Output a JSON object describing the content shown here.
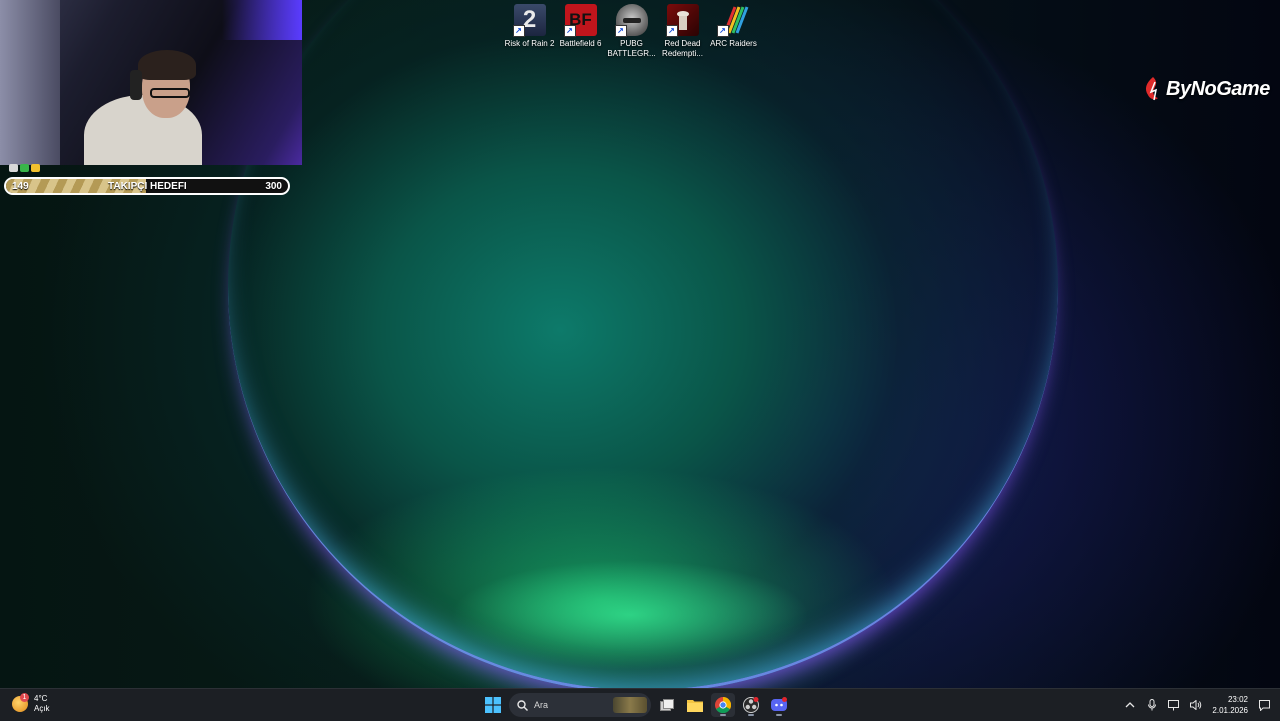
{
  "desktop": {
    "icons": [
      {
        "label": "Risk of Rain 2",
        "icon": "risk-of-rain-2-icon",
        "glyph": "2"
      },
      {
        "label": "Battlefield 6",
        "icon": "battlefield-6-icon",
        "glyph": "BF"
      },
      {
        "label": "PUBG BATTLEGR...",
        "icon": "pubg-icon",
        "glyph": ""
      },
      {
        "label": "Red Dead Redempti...",
        "icon": "red-dead-redemption-icon",
        "glyph": ""
      },
      {
        "label": "ARC Raiders",
        "icon": "arc-raiders-icon",
        "glyph": ""
      }
    ],
    "watermark": "ByNoGame"
  },
  "overlay": {
    "follower_goal": {
      "label": "TAKIPÇI HEDEFI",
      "current": "149",
      "target": "300",
      "progress_fraction": 0.4967
    }
  },
  "taskbar": {
    "weather": {
      "temp": "4°C",
      "condition": "Açık",
      "badge": "1"
    },
    "search_placeholder": "Ara",
    "apps": [
      "start-icon",
      "search-icon",
      "task-view-icon",
      "file-explorer-icon",
      "chrome-icon",
      "obs-icon",
      "discord-icon"
    ],
    "clock": {
      "time": "23:02",
      "date": "2.01.2026"
    }
  },
  "colors": {
    "taskbar_bg": "#1c1f24",
    "progress_fill": "#b49a55",
    "battlefield_red": "#c0151c",
    "bynogame_red": "#e02a2a"
  }
}
